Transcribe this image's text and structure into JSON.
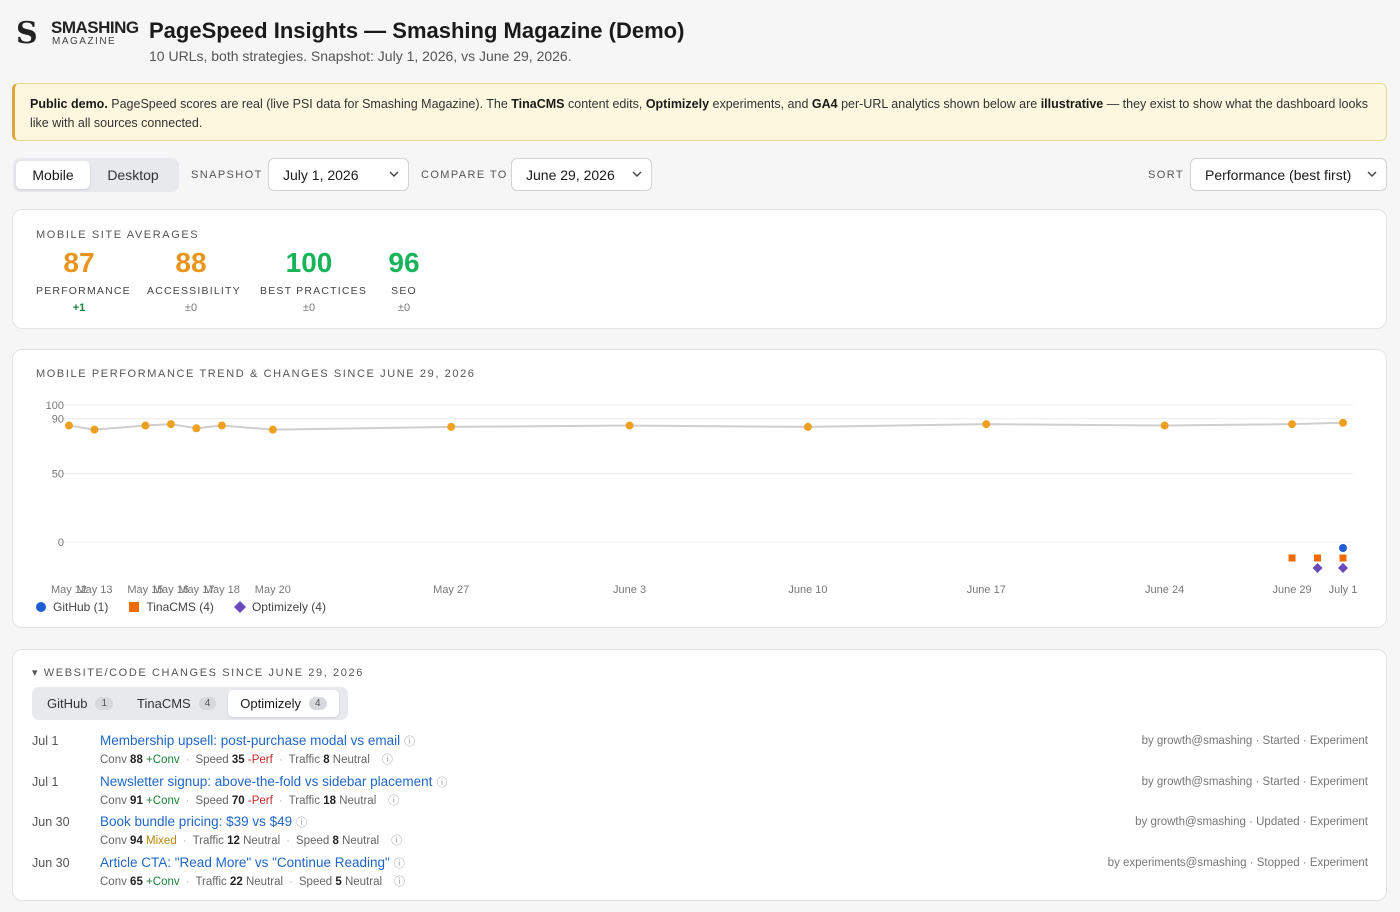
{
  "brand": {
    "logo_mark": "S",
    "name": "SMASHING",
    "sub": "MAGAZINE"
  },
  "header": {
    "title": "PageSpeed Insights — Smashing Magazine (Demo)",
    "subtitle": "10 URLs, both strategies. Snapshot: July 1, 2026, vs June 29, 2026."
  },
  "banner": {
    "lead": "Public demo.",
    "t1": " PageSpeed scores are real (live PSI data for Smashing Magazine). The ",
    "b1": "TinaCMS",
    "t2": " content edits, ",
    "b2": "Optimizely",
    "t3": " experiments, and ",
    "b3": "GA4",
    "t4": " per-URL analytics shown below are ",
    "b4": "illustrative",
    "t5": " — they exist to show what the dashboard looks like with all sources connected."
  },
  "controls": {
    "strategy_mobile": "Mobile",
    "strategy_desktop": "Desktop",
    "active_strategy": "Mobile",
    "snapshot_label": "SNAPSHOT",
    "snapshot_value": "July 1, 2026",
    "compare_label": "COMPARE TO",
    "compare_value": "June 29, 2026",
    "sort_label": "SORT",
    "sort_value": "Performance (best first)"
  },
  "averages": {
    "title": "MOBILE SITE AVERAGES",
    "scores": [
      {
        "value": "87",
        "label": "PERFORMANCE",
        "delta": "+1"
      },
      {
        "value": "88",
        "label": "ACCESSIBILITY",
        "delta": "±0"
      },
      {
        "value": "100",
        "label": "BEST PRACTICES",
        "delta": "±0"
      },
      {
        "value": "96",
        "label": "SEO",
        "delta": "±0"
      }
    ],
    "colors": {
      "orange": "#e8941d",
      "green": "#19b35a",
      "delta_positive": "#1a7f37"
    }
  },
  "chart_data": {
    "type": "line",
    "title": "MOBILE PERFORMANCE TREND & CHANGES SINCE JUNE 29, 2026",
    "y_ticks": [
      0,
      50,
      90,
      100
    ],
    "ylim": [
      0,
      100
    ],
    "x_tick_labels": [
      {
        "label": "May 12",
        "day": 0
      },
      {
        "label": "May 13",
        "day": 1
      },
      {
        "label": "May 15",
        "day": 3
      },
      {
        "label": "May 16",
        "day": 4
      },
      {
        "label": "May 17",
        "day": 5
      },
      {
        "label": "May 18",
        "day": 6
      },
      {
        "label": "May 20",
        "day": 8
      },
      {
        "label": "May 27",
        "day": 15
      },
      {
        "label": "June 3",
        "day": 22
      },
      {
        "label": "June 10",
        "day": 29
      },
      {
        "label": "June 17",
        "day": 36
      },
      {
        "label": "June 24",
        "day": 43
      },
      {
        "label": "June 29",
        "day": 48
      },
      {
        "label": "July 1",
        "day": 50
      }
    ],
    "series": [
      {
        "name": "Performance",
        "color": "#f0a020",
        "points": [
          {
            "date": "May 12",
            "day": 0,
            "value": 85
          },
          {
            "date": "May 13",
            "day": 1,
            "value": 82
          },
          {
            "date": "May 15",
            "day": 3,
            "value": 85
          },
          {
            "date": "May 16",
            "day": 4,
            "value": 86
          },
          {
            "date": "May 17",
            "day": 5,
            "value": 83
          },
          {
            "date": "May 18",
            "day": 6,
            "value": 85
          },
          {
            "date": "May 20",
            "day": 8,
            "value": 82
          },
          {
            "date": "May 27",
            "day": 15,
            "value": 84
          },
          {
            "date": "June 3",
            "day": 22,
            "value": 85
          },
          {
            "date": "June 10",
            "day": 29,
            "value": 84
          },
          {
            "date": "June 17",
            "day": 36,
            "value": 86
          },
          {
            "date": "June 24",
            "day": 43,
            "value": 85
          },
          {
            "date": "June 29",
            "day": 48,
            "value": 86
          },
          {
            "date": "July 1",
            "day": 50,
            "value": 87
          }
        ]
      }
    ],
    "events": [
      {
        "source": "TinaCMS",
        "day": 48,
        "row": 0
      },
      {
        "source": "TinaCMS",
        "day": 49,
        "row": 0
      },
      {
        "source": "Optimizely",
        "day": 49,
        "row": 1
      },
      {
        "source": "GitHub",
        "day": 50,
        "row": -1
      },
      {
        "source": "TinaCMS",
        "day": 50,
        "row": 0
      },
      {
        "source": "Optimizely",
        "day": 50,
        "row": 1
      }
    ],
    "legend": [
      {
        "label": "GitHub (1)",
        "color": "#1f5fd6",
        "shape": "circle"
      },
      {
        "label": "TinaCMS (4)",
        "color": "#ef6c00",
        "shape": "square"
      },
      {
        "label": "Optimizely (4)",
        "color": "#6a4bbc",
        "shape": "diamond"
      }
    ],
    "line_color": "#cfcfcf",
    "grid": true
  },
  "changes": {
    "title": "WEBSITE/CODE CHANGES SINCE JUNE 29, 2026",
    "collapse_icon": "▾",
    "tabs": [
      {
        "label": "GitHub",
        "count": "1"
      },
      {
        "label": "TinaCMS",
        "count": "4"
      },
      {
        "label": "Optimizely",
        "count": "4"
      }
    ],
    "active_tab": "Optimizely",
    "info_icon": "ⓘ",
    "rows": [
      {
        "date": "Jul 1",
        "title": "Membership upsell: post-purchase modal vs email",
        "metrics": [
          {
            "name": "Conv",
            "value": "88",
            "tag": "+Conv",
            "kind": "pos"
          },
          {
            "name": "Speed",
            "value": "35",
            "tag": "-Perf",
            "kind": "neg"
          },
          {
            "name": "Traffic",
            "value": "8",
            "tag": "Neutral",
            "kind": "neutral"
          }
        ],
        "meta": "by growth@smashing · Started · Experiment"
      },
      {
        "date": "Jul 1",
        "title": "Newsletter signup: above-the-fold vs sidebar placement",
        "metrics": [
          {
            "name": "Conv",
            "value": "91",
            "tag": "+Conv",
            "kind": "pos"
          },
          {
            "name": "Speed",
            "value": "70",
            "tag": "-Perf",
            "kind": "neg"
          },
          {
            "name": "Traffic",
            "value": "18",
            "tag": "Neutral",
            "kind": "neutral"
          }
        ],
        "meta": "by growth@smashing · Started · Experiment"
      },
      {
        "date": "Jun 30",
        "title": "Book bundle pricing: $39 vs $49",
        "metrics": [
          {
            "name": "Conv",
            "value": "94",
            "tag": "Mixed",
            "kind": "mix"
          },
          {
            "name": "Traffic",
            "value": "12",
            "tag": "Neutral",
            "kind": "neutral"
          },
          {
            "name": "Speed",
            "value": "8",
            "tag": "Neutral",
            "kind": "neutral"
          }
        ],
        "meta": "by growth@smashing · Updated · Experiment"
      },
      {
        "date": "Jun 30",
        "title": "Article CTA: \"Read More\" vs \"Continue Reading\"",
        "metrics": [
          {
            "name": "Conv",
            "value": "65",
            "tag": "+Conv",
            "kind": "pos"
          },
          {
            "name": "Traffic",
            "value": "22",
            "tag": "Neutral",
            "kind": "neutral"
          },
          {
            "name": "Speed",
            "value": "5",
            "tag": "Neutral",
            "kind": "neutral"
          }
        ],
        "meta": "by experiments@smashing · Stopped · Experiment"
      }
    ]
  }
}
